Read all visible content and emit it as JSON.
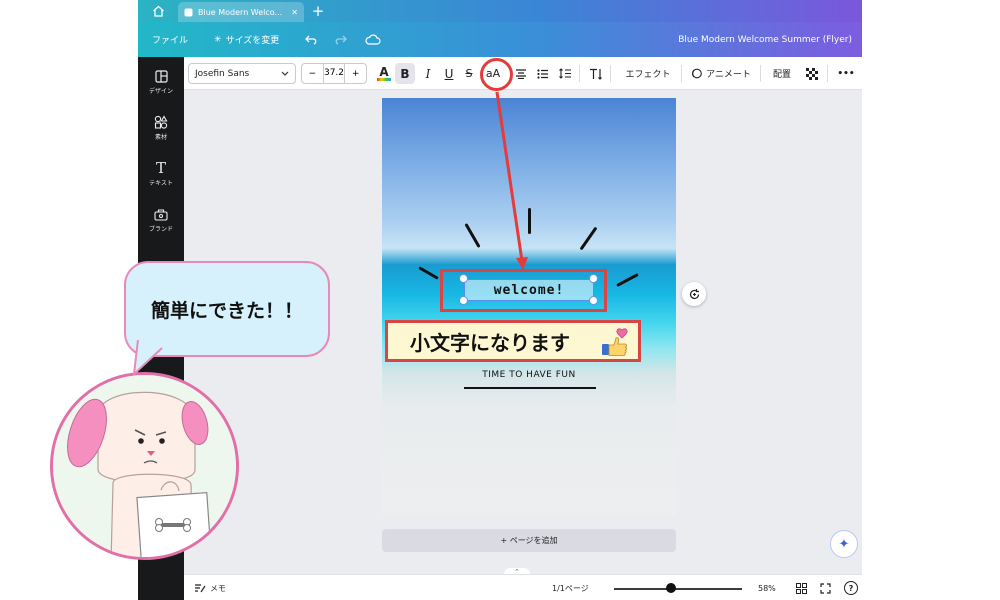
{
  "tabbar": {
    "doc_tab_title": "Blue Modern Welco...",
    "close": "✕",
    "new_tab": "+"
  },
  "menubar": {
    "file": "ファイル",
    "resize": "サイズを変更",
    "document_title": "Blue Modern Welcome Summer (Flyer)"
  },
  "sidebar": {
    "items": [
      {
        "label": "デザイン",
        "icon": "layout-icon"
      },
      {
        "label": "素材",
        "icon": "elements-icon"
      },
      {
        "label": "テキスト",
        "icon": "text-icon"
      },
      {
        "label": "ブランド",
        "icon": "brand-icon"
      }
    ]
  },
  "toolbar": {
    "font_name": "Josefin Sans",
    "font_size": "37.2",
    "minus": "−",
    "plus": "+",
    "text_color_glyph": "A",
    "bold": "B",
    "italic": "I",
    "underline": "U",
    "strike": "S",
    "case": "aA",
    "effects": "エフェクト",
    "animate": "アニメート",
    "position": "配置",
    "more": "•••"
  },
  "canvas": {
    "welcome_text": "welcome!",
    "tagline": "TIME TO HAVE FUN"
  },
  "add_page": "+ ページを追加",
  "footer": {
    "notes": "メモ",
    "page_count": "1/1ページ",
    "zoom": "58%",
    "help": "?"
  },
  "annotations": {
    "note": "小文字になります",
    "speech": "簡単にできた！！",
    "accent_color": "#e53b3b"
  }
}
